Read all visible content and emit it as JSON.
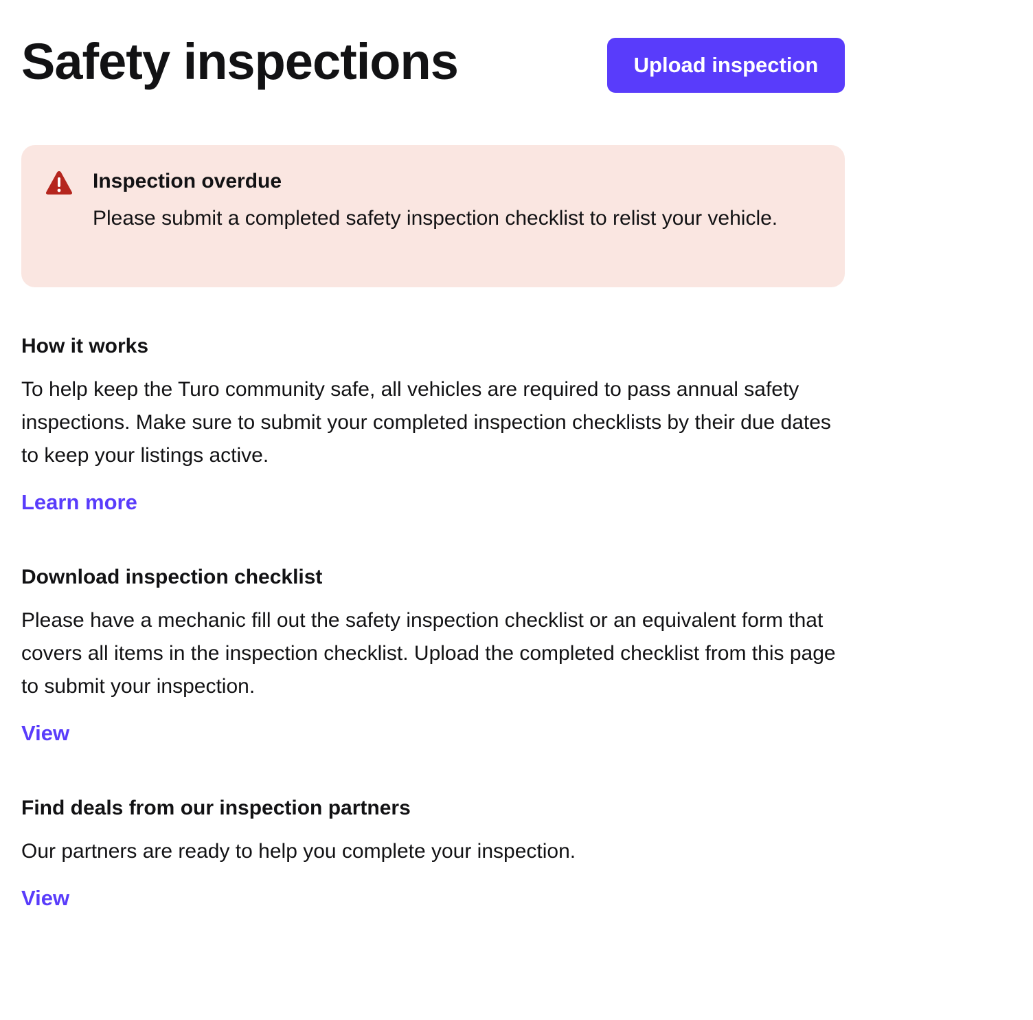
{
  "header": {
    "title": "Safety inspections",
    "upload_button_label": "Upload inspection"
  },
  "alert": {
    "icon": "warning-triangle-icon",
    "title": "Inspection overdue",
    "message": "Please submit a completed safety inspection checklist to relist your vehicle."
  },
  "sections": [
    {
      "heading": "How it works",
      "body": "To help keep the Turo community safe, all vehicles are required to pass annual safety inspections. Make sure to submit your completed inspection checklists by their due dates to keep your listings active.",
      "link": "Learn more"
    },
    {
      "heading": "Download inspection checklist",
      "body": "Please have a mechanic fill out the safety inspection checklist or an equivalent form that covers all items in the inspection checklist. Upload the completed checklist from this page to submit your inspection.",
      "link": "View"
    },
    {
      "heading": "Find deals from our inspection partners",
      "body": "Our partners are ready to help you complete your inspection.",
      "link": "View"
    }
  ],
  "colors": {
    "accent": "#593cfb",
    "alert_background": "#fae6e1",
    "alert_icon": "#b5261e",
    "text": "#121214"
  }
}
